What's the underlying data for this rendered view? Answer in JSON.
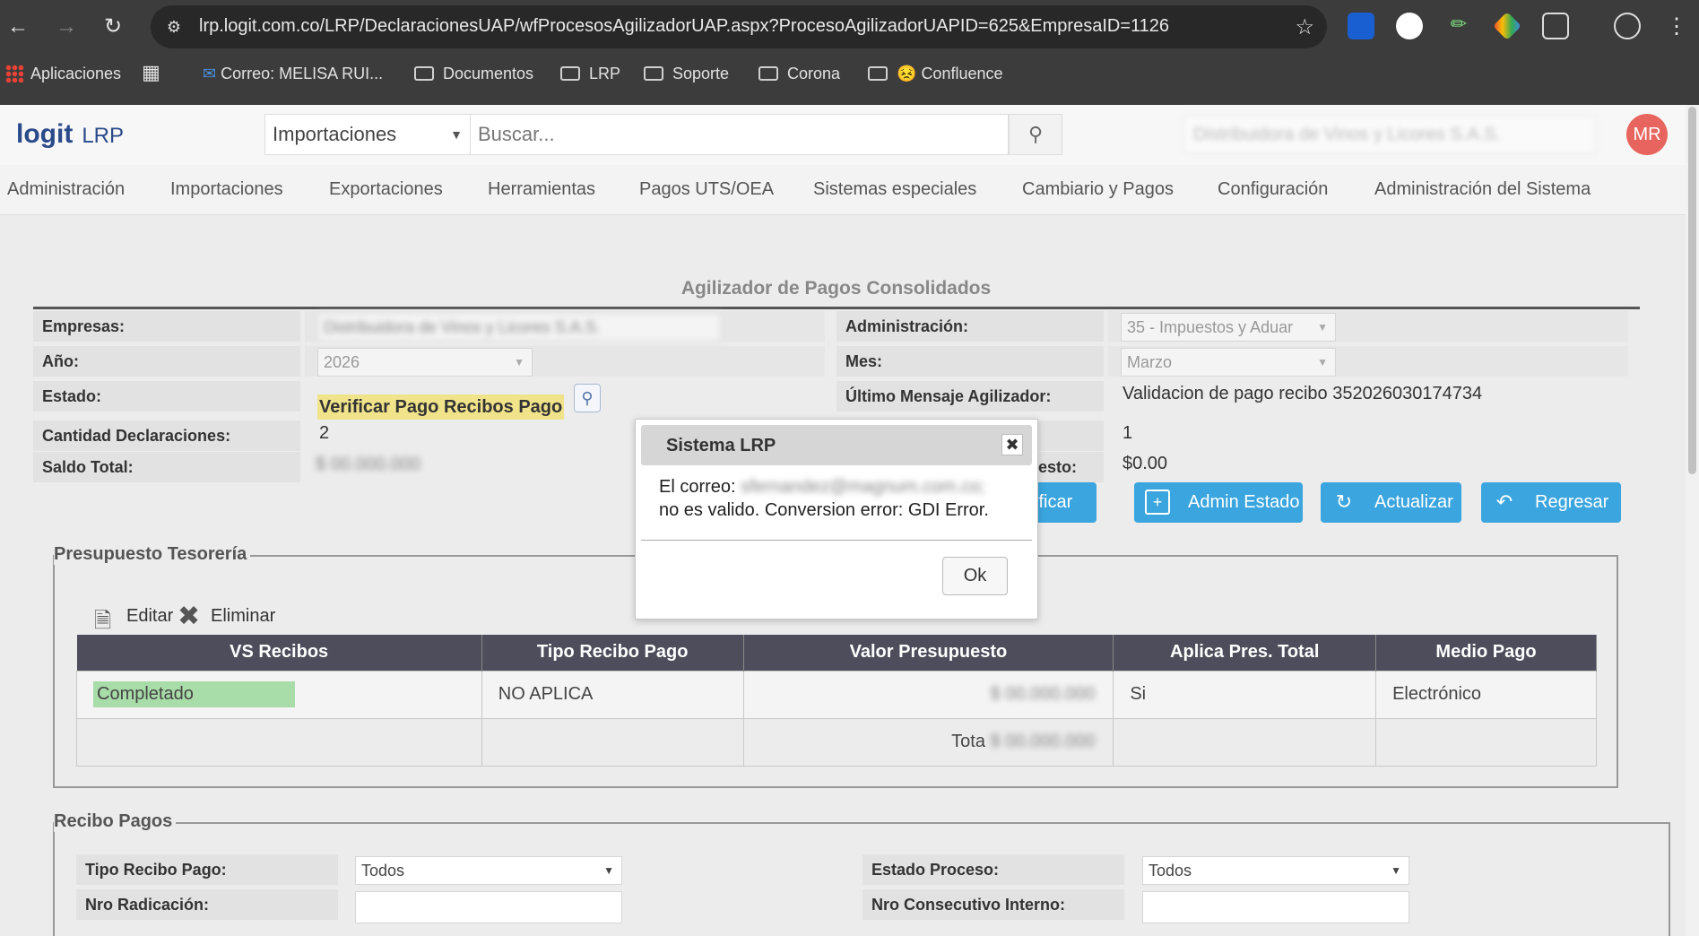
{
  "browser": {
    "url": "lrp.logit.com.co/LRP/DeclaracionesUAP/wfProcesosAgilizadorUAP.aspx?ProcesoAgilizadorUAPID=625&EmpresaID=1126",
    "bookmarks": [
      "Aplicaciones",
      "Correo: MELISA RUI...",
      "Documentos",
      "LRP",
      "Soporte",
      "Corona",
      "Confluence"
    ]
  },
  "header": {
    "logo": "logit",
    "app_name": "LRP",
    "search_category": "Importaciones",
    "search_placeholder": "Buscar...",
    "company": "Distribuidora de Vinos y Licores S.A.S.",
    "avatar_initials": "MR"
  },
  "menu": [
    "Administración",
    "Importaciones",
    "Exportaciones",
    "Herramientas",
    "Pagos UTS/OEA",
    "Sistemas especiales",
    "Cambiario y Pagos",
    "Configuración",
    "Administración del Sistema"
  ],
  "page": {
    "title": "Agilizador de Pagos Consolidados",
    "labels": {
      "empresas": "Empresas:",
      "anio": "Año:",
      "estado": "Estado:",
      "cantidad": "Cantidad Declaraciones:",
      "saldo": "Saldo Total:",
      "administracion": "Administración:",
      "mes": "Mes:",
      "ultimo_mensaje": "Último Mensaje Agilizador:",
      "presupuesto_partial": "esto:"
    },
    "values": {
      "empresa": "Distribuidora de Vinos y Licores S.A.S.",
      "anio": "2026",
      "estado": "Verificar Pago Recibos Pago",
      "cantidad": "2",
      "saldo": "$ 00.000.000",
      "administracion": "35 - Impuestos y Aduar",
      "mes": "Marzo",
      "ultimo_mensaje": "Validacion de pago recibo 352026030174734",
      "count_right": "1",
      "presupuesto_value": "$0.00"
    },
    "buttons": {
      "verificar": "ificar",
      "admin_estado": "Admin Estado",
      "actualizar": "Actualizar",
      "regresar": "Regresar"
    }
  },
  "presupuesto": {
    "legend": "Presupuesto Tesorería",
    "edit_label": "Editar",
    "delete_label": "Eliminar",
    "columns": [
      "VS Recibos",
      "Tipo Recibo Pago",
      "Valor Presupuesto",
      "Aplica Pres. Total",
      "Medio Pago"
    ],
    "row": {
      "vs_recibos": "Completado",
      "tipo": "NO APLICA",
      "valor": "$ 00.000.000",
      "aplica": "Si",
      "medio": "Electrónico"
    },
    "total_label": "Tota",
    "total_value": "$ 00.000.000"
  },
  "recibos": {
    "legend": "Recibo Pagos",
    "tipo_label": "Tipo Recibo Pago:",
    "tipo_value": "Todos",
    "estado_label": "Estado Proceso:",
    "estado_value": "Todos",
    "radicacion_label": "Nro Radicación:",
    "consecutivo_label": "Nro Consecutivo Interno:"
  },
  "modal": {
    "title": "Sistema LRP",
    "message_prefix": "El correo:",
    "email": "sfernandez@magnum.com.co;",
    "message_suffix": "no es valido. Conversion error: GDI Error.",
    "ok_label": "Ok"
  },
  "colors": {
    "primary_button": "#3aa5de",
    "table_header": "#4d4d5c",
    "estado_highlight": "#f0e38a",
    "status_completed": "#a8dca8",
    "avatar": "#e8655f"
  }
}
